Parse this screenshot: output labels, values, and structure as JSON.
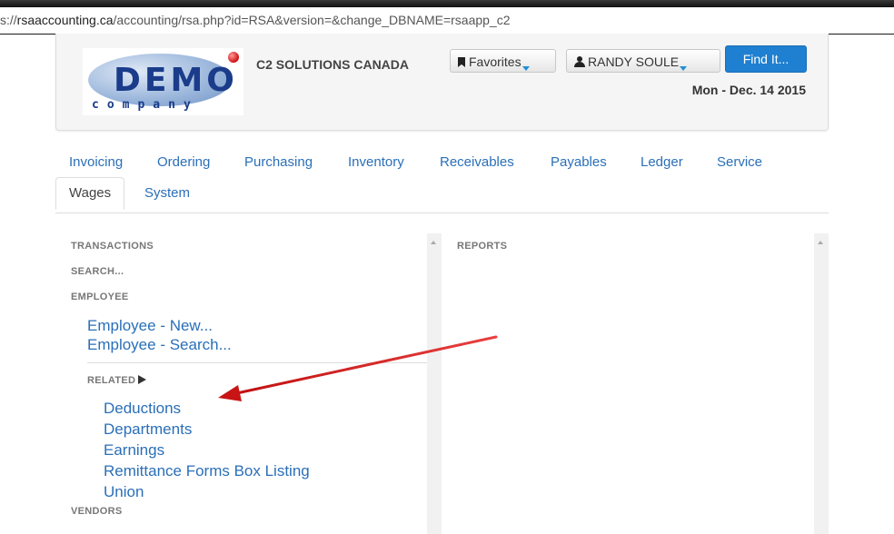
{
  "url": {
    "prefix": "s://",
    "host": "rsaaccounting.ca",
    "path": "/accounting/rsa.php?id=RSA&version=&change_DBNAME=rsaapp_c2"
  },
  "header": {
    "logo_big": "DEMO",
    "logo_small": "company",
    "company_name": "C2 SOLUTIONS CANADA",
    "favorites_label": "Favorites",
    "user_label": "RANDY SOULE",
    "find_label": "Find It...",
    "date": "Mon - Dec. 14 2015"
  },
  "tabs": [
    {
      "label": "Invoicing"
    },
    {
      "label": "Ordering"
    },
    {
      "label": "Purchasing"
    },
    {
      "label": "Inventory"
    },
    {
      "label": "Receivables"
    },
    {
      "label": "Payables"
    },
    {
      "label": "Ledger"
    },
    {
      "label": "Service"
    },
    {
      "label": "Wages"
    },
    {
      "label": "System"
    }
  ],
  "left_panel": {
    "transactions": "TRANSACTIONS",
    "search": "SEARCH...",
    "employee": "EMPLOYEE",
    "employee_links": [
      "Employee - New...",
      "Employee - Search..."
    ],
    "related": "RELATED",
    "related_links": [
      "Deductions",
      "Departments",
      "Earnings",
      "Remittance Forms Box Listing",
      "Union"
    ],
    "vendors": "VENDORS"
  },
  "right_panel": {
    "reports": "REPORTS"
  },
  "colors": {
    "link": "#2a6fb8",
    "accent": "#1f7fd0",
    "arrow": "#d21a1a"
  },
  "icons": [
    "bookmark-icon",
    "user-icon",
    "caret-down-icon",
    "triangle-right-icon",
    "red-arrow-annotation"
  ]
}
